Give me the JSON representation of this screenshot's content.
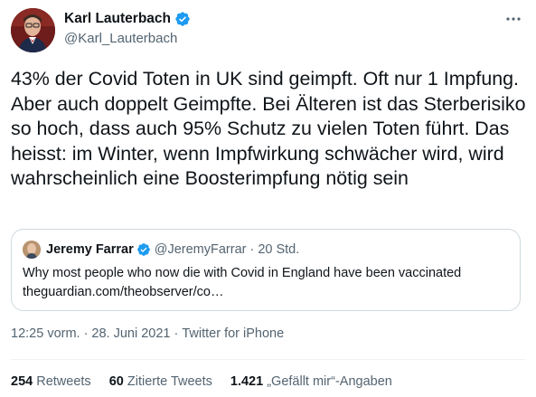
{
  "author": {
    "display_name": "Karl Lauterbach",
    "handle": "@Karl_Lauterbach",
    "verified": true,
    "avatar_icon": "profile-photo"
  },
  "tweet": {
    "text": "43% der Covid Toten in UK sind geimpft. Oft nur 1 Impfung. Aber auch doppelt Geimpfte. Bei Älteren ist das Sterberisiko so hoch, dass auch 95% Schutz zu vielen Toten führt. Das heisst: im Winter, wenn Impfwirkung schwächer wird, wird wahrscheinlich eine Boosterimpfung nötig sein"
  },
  "quoted": {
    "display_name": "Jeremy Farrar",
    "handle": "@JeremyFarrar",
    "separator": "·",
    "time": "20 Std.",
    "verified": true,
    "text_line1": "Why most people who now die with Covid in England have been vaccinated",
    "text_line2": "theguardian.com/theobserver/co…"
  },
  "meta": {
    "time": "12:25 vorm.",
    "date": "28. Juni 2021",
    "source": "Twitter for iPhone",
    "separator": "·"
  },
  "stats": {
    "retweets_count": "254",
    "retweets_label": "Retweets",
    "quotes_count": "60",
    "quotes_label": "Zitierte Tweets",
    "likes_count": "1.421",
    "likes_label": "„Gefällt mir“-Angaben"
  },
  "colors": {
    "text": "#0f1419",
    "secondary": "#536471",
    "verified": "#1d9bf0",
    "border": "#cfd9de"
  }
}
